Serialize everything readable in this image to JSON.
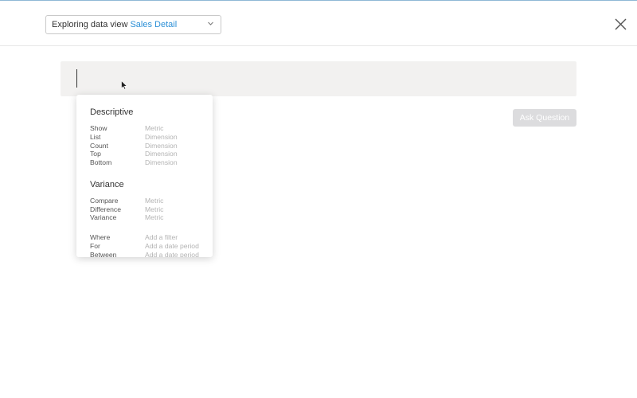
{
  "header": {
    "view_prefix": "Exploring data view",
    "view_name": "Sales Detail",
    "chevron_icon": "chevron-down-icon",
    "close_icon": "close-icon"
  },
  "query": {
    "value": "",
    "ask_button_label": "Ask Question"
  },
  "suggestions": {
    "sections": [
      {
        "title": "Descriptive",
        "items": [
          {
            "keyword": "Show",
            "hint": "Metric"
          },
          {
            "keyword": "List",
            "hint": "Dimension"
          },
          {
            "keyword": "Count",
            "hint": "Dimension"
          },
          {
            "keyword": "Top",
            "hint": "Dimension"
          },
          {
            "keyword": "Bottom",
            "hint": "Dimension"
          }
        ]
      },
      {
        "title": "Variance",
        "items": [
          {
            "keyword": "Compare",
            "hint": "Metric"
          },
          {
            "keyword": "Difference",
            "hint": "Metric"
          },
          {
            "keyword": "Variance",
            "hint": "Metric"
          }
        ]
      },
      {
        "title": "",
        "items": [
          {
            "keyword": "Where",
            "hint": "Add a filter"
          },
          {
            "keyword": "For",
            "hint": "Add a date period"
          },
          {
            "keyword": "Between",
            "hint": "Add a date period"
          }
        ]
      }
    ]
  },
  "colors": {
    "accent": "#2b8fd6",
    "query_bar_bg": "#f2f1f0",
    "ask_button_disabled": "#dcdcde"
  }
}
